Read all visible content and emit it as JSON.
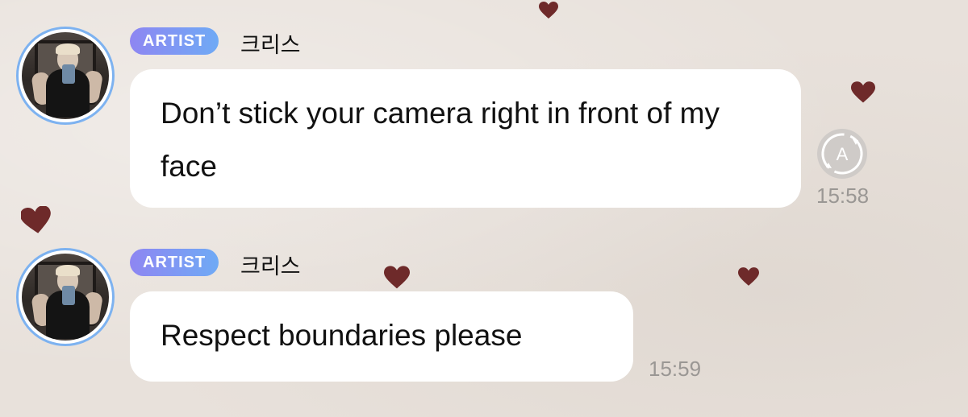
{
  "messages": [
    {
      "badge": "ARTIST",
      "sender": "크리스",
      "text": "Don’t stick your camera right in front of my face",
      "time": "15:58",
      "translate_icon": "translate-icon"
    },
    {
      "badge": "ARTIST",
      "sender": "크리스",
      "text": "Respect boundaries please",
      "time": "15:59"
    }
  ],
  "colors": {
    "background": "#e8e1db",
    "badge_gradient_start": "#8e86f2",
    "badge_gradient_end": "#6faaf5",
    "avatar_ring": "#7db2f0",
    "heart": "#6e2a2a",
    "timestamp": "#9a9794"
  },
  "decorations": [
    "heart-icon"
  ]
}
